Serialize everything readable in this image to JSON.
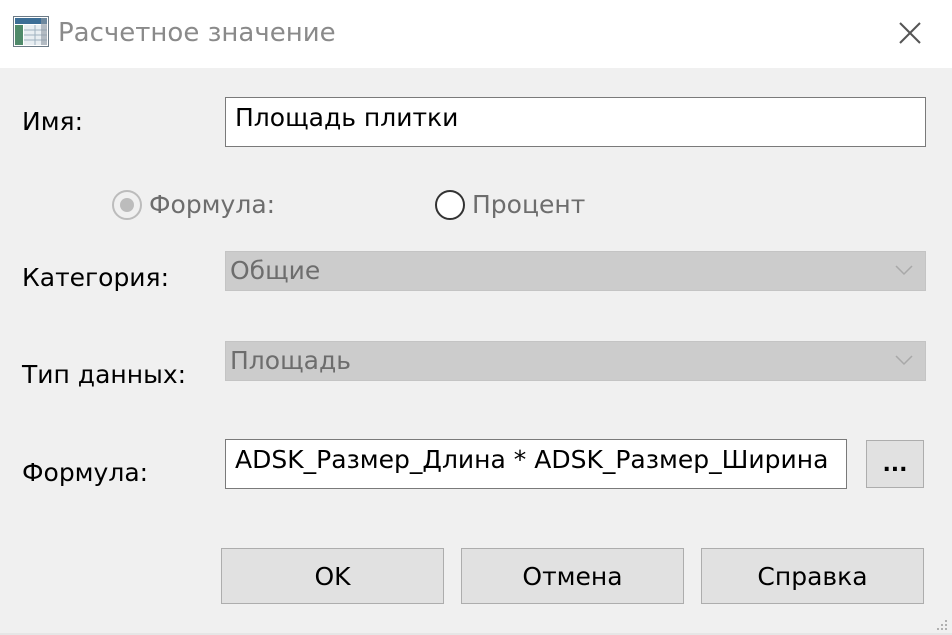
{
  "window": {
    "title": "Расчетное значение",
    "icons": {
      "app": "app-table-icon",
      "close": "close-icon"
    }
  },
  "form": {
    "name_label": "Имя:",
    "name_value": "Площадь плитки",
    "radio_formula_label": "Формула:",
    "radio_formula_checked": true,
    "radio_percent_label": "Процент",
    "radio_percent_checked": false,
    "category_label": "Категория:",
    "category_value": "Общие",
    "datatype_label": "Тип данных:",
    "datatype_value": "Площадь",
    "formula_label": "Формула:",
    "formula_value": "ADSK_Размер_Длина * ADSK_Размер_Ширина",
    "browse_label": "..."
  },
  "buttons": {
    "ok": "OK",
    "cancel": "Отмена",
    "help": "Справка"
  },
  "colors": {
    "background": "#f0f0f0",
    "titlebar": "#ffffff",
    "disabled_field": "#cccccc",
    "disabled_text": "#6d6d6d",
    "button": "#e1e1e1"
  }
}
